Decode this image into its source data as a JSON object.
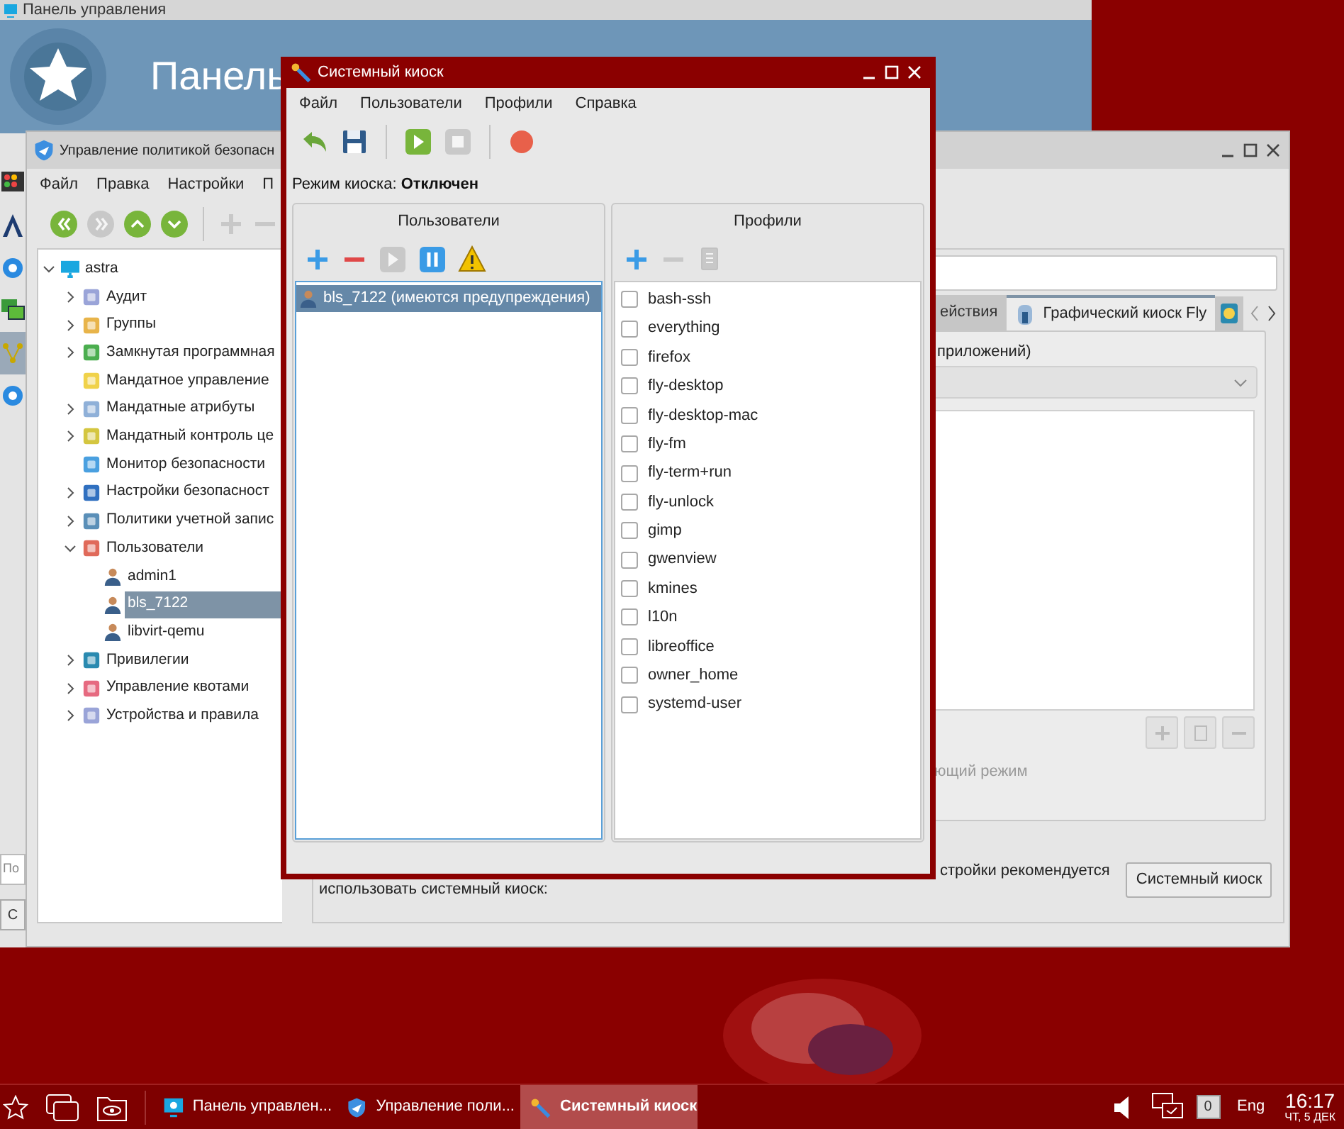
{
  "control_panel": {
    "title": "Панель управления",
    "banner_title": "Панель",
    "sidebar_items": [
      {
        "kind": "lights",
        "selected": false
      },
      {
        "kind": "pen",
        "selected": false
      },
      {
        "kind": "gear",
        "selected": false
      },
      {
        "kind": "monitors",
        "selected": false
      },
      {
        "kind": "network",
        "selected": true
      },
      {
        "kind": "gear",
        "selected": false
      }
    ],
    "search_placeholder": "По",
    "button": "С"
  },
  "policy_window": {
    "title": "Управление политикой безопасн",
    "menu": [
      "Файл",
      "Правка",
      "Настройки",
      "П"
    ],
    "toolbar": [
      {
        "kind": "first",
        "disabled": false
      },
      {
        "kind": "last",
        "disabled": true
      },
      {
        "kind": "up",
        "disabled": false
      },
      {
        "kind": "down",
        "disabled": false
      },
      {
        "kind": "separator"
      },
      {
        "kind": "add",
        "disabled": true
      },
      {
        "kind": "remove",
        "disabled": true
      }
    ],
    "tree": [
      {
        "label": "astra",
        "selected": false,
        "expanded": true,
        "children": [
          {
            "label": "Аудит",
            "selected": false,
            "expanded": false
          },
          {
            "label": "Группы",
            "selected": false,
            "expanded": false
          },
          {
            "label": "Замкнутая программная",
            "selected": false,
            "expanded": false
          },
          {
            "label": "Мандатное управление",
            "selected": false
          },
          {
            "label": "Мандатные атрибуты",
            "selected": false,
            "expanded": false
          },
          {
            "label": "Мандатный контроль це",
            "selected": false,
            "expanded": false
          },
          {
            "label": "Монитор безопасности",
            "selected": false
          },
          {
            "label": "Настройки безопасност",
            "selected": false,
            "expanded": false
          },
          {
            "label": "Политики учетной запис",
            "selected": false,
            "expanded": false
          },
          {
            "label": "Пользователи",
            "selected": false,
            "expanded": true,
            "children": [
              {
                "label": "admin1",
                "selected": false
              },
              {
                "label": "bls_7122",
                "selected": true
              },
              {
                "label": "libvirt-qemu",
                "selected": false
              }
            ]
          },
          {
            "label": "Привилегии",
            "selected": false,
            "expanded": false
          },
          {
            "label": "Управление квотами",
            "selected": false,
            "expanded": false
          },
          {
            "label": "Устройства и правила",
            "selected": false,
            "expanded": false
          }
        ]
      }
    ],
    "tabs": [
      {
        "kind": "text",
        "label": "ействия",
        "selected": false
      },
      {
        "kind": "text",
        "label": "Графический киоск Fly",
        "selected": true
      },
      {
        "kind": "icon",
        "selected": false
      }
    ],
    "group_label": "приложений)",
    "list_buttons": [
      {
        "kind": "add",
        "disabled": true
      },
      {
        "kind": "edit",
        "disabled": true
      },
      {
        "kind": "remove",
        "disabled": true
      }
    ],
    "option": {
      "label": "ющий режим",
      "disabled": true
    },
    "note_lines": [
      "стройки рекомендуется",
      "использовать системный киоск:"
    ],
    "kiosk_button": "Системный киоск"
  },
  "kiosk_window": {
    "title": "Системный киоск",
    "menu": [
      "Файл",
      "Пользователи",
      "Профили",
      "Справка"
    ],
    "toolbar": [
      {
        "kind": "undo",
        "disabled": false
      },
      {
        "kind": "save",
        "disabled": false
      },
      {
        "kind": "separator"
      },
      {
        "kind": "start",
        "disabled": false
      },
      {
        "kind": "stop",
        "disabled": true
      },
      {
        "kind": "separator"
      },
      {
        "kind": "record",
        "disabled": false
      }
    ],
    "mode": "Режим киоска: **Отключен**",
    "users": {
      "title": "Пользователи",
      "toolbar": [
        {
          "kind": "add",
          "disabled": false
        },
        {
          "kind": "remove",
          "disabled": false
        },
        {
          "kind": "play",
          "disabled": true
        },
        {
          "kind": "pause",
          "disabled": false
        },
        {
          "kind": "warning",
          "disabled": false
        }
      ],
      "items": [
        {
          "label": "bls_7122 (имеются предупреждения)",
          "selected": true
        }
      ]
    },
    "profiles": {
      "title": "Профили",
      "toolbar": [
        {
          "kind": "add",
          "disabled": false
        },
        {
          "kind": "remove",
          "disabled": true
        },
        {
          "kind": "copy",
          "disabled": true
        }
      ],
      "items": [
        {
          "label": "bash-ssh",
          "checked": false
        },
        {
          "label": "everything",
          "checked": false
        },
        {
          "label": "firefox",
          "checked": false
        },
        {
          "label": "fly-desktop",
          "checked": false
        },
        {
          "label": "fly-desktop-mac",
          "checked": false
        },
        {
          "label": "fly-fm",
          "checked": false
        },
        {
          "label": "fly-term+run",
          "checked": false
        },
        {
          "label": "fly-unlock",
          "checked": false
        },
        {
          "label": "gimp",
          "checked": false
        },
        {
          "label": "gwenview",
          "checked": false
        },
        {
          "label": "kmines",
          "checked": false
        },
        {
          "label": "l10n",
          "checked": false
        },
        {
          "label": "libreoffice",
          "checked": false
        },
        {
          "label": "owner_home",
          "checked": false
        },
        {
          "label": "systemd-user",
          "checked": false
        }
      ]
    }
  },
  "taskbar": {
    "tasks": [
      {
        "label": "Панель управлен...",
        "kind": "panel",
        "selected": false
      },
      {
        "label": "Управление поли...",
        "kind": "shield",
        "selected": false
      },
      {
        "label": "Системный киоск",
        "kind": "kiosk",
        "selected": true
      }
    ],
    "badge": "0",
    "layout": "Eng",
    "time": "16:17",
    "date": "ЧТ, 5 ДЕК"
  }
}
